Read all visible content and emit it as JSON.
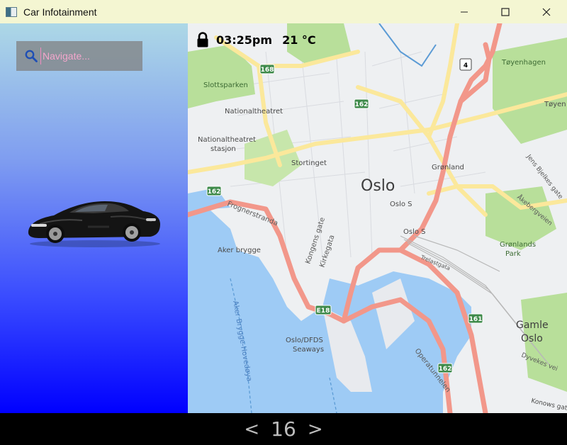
{
  "window": {
    "title": "Car Infotainment",
    "controls": [
      "minimize-icon",
      "maximize-icon",
      "close-icon"
    ]
  },
  "search": {
    "placeholder": "Navigate...",
    "value": ""
  },
  "status": {
    "lock_icon": "lock-icon",
    "time": "03:25pm",
    "temperature": "21 °C"
  },
  "map": {
    "labels": {
      "oslo": "Oslo",
      "slottsparken": "Slottsparken",
      "nationaltheatret": "Nationaltheatret",
      "nationaltheatret_stasjon_1": "Nationaltheatret",
      "nationaltheatret_stasjon_2": "stasjon",
      "stortinget": "Stortinget",
      "gronland": "Grønland",
      "toyenhagen": "Tøyenhagen",
      "toyen": "Tøyen",
      "frognerstranda": "Frognerstranda",
      "aker_brygge": "Aker brygge",
      "kongens_gate": "Kongens gate",
      "kirkegata": "Kirkegata",
      "oslo_s_1": "Oslo S",
      "oslo_s_2": "Oslo S",
      "trelastgata": "Trelastgata",
      "gronlands_park_1": "Grønlands",
      "gronlands_park_2": "Park",
      "gamle_oslo_1": "Gamle",
      "gamle_oslo_2": "Oslo",
      "oslo_dfds_1": "Oslo/DFDS",
      "oslo_dfds_2": "Seaways",
      "operatunnelen": "Operatunnelen",
      "aker_brygge_hovedoya": "Aker Brygge-Hovedøya",
      "jens_bjelkes_gate": "Jens Bjelkes gate",
      "akebergveien": "Åkebergveien",
      "dyvekes_vei": "Dyvekes vei",
      "konows_gate": "Konows gate",
      "e18": "E18"
    },
    "road_shields": [
      "168",
      "162",
      "162",
      "161",
      "162",
      "4",
      "E18"
    ]
  },
  "pager": {
    "prev": "<",
    "page": "16",
    "next": ">"
  },
  "colors": {
    "titlebar": "#f4f6d2",
    "panel_top": "#add8e6",
    "panel_bottom": "#0000ff",
    "search_bg": "#808080",
    "placeholder": "#f4a6cc",
    "water": "#9ecbf5",
    "park": "#b8df9a",
    "main_road": "#f2978a",
    "yellow_road": "#fbe89b"
  }
}
